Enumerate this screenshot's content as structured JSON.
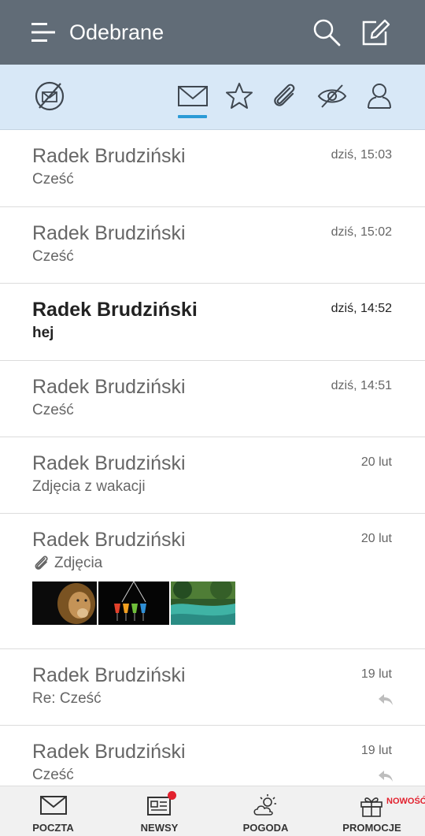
{
  "appbar": {
    "title": "Odebrane",
    "menu_icon": "hamburger-icon",
    "search_icon": "search-icon",
    "compose_icon": "compose-icon",
    "background": "#616c77"
  },
  "filters": {
    "items": [
      {
        "icon": "unread-off-icon",
        "active": false
      },
      {
        "icon": "envelope-icon",
        "active": true
      },
      {
        "icon": "star-icon",
        "active": false
      },
      {
        "icon": "paperclip-icon",
        "active": false
      },
      {
        "icon": "eye-off-icon",
        "active": false
      },
      {
        "icon": "person-icon",
        "active": false
      }
    ],
    "background": "#d8e8f7",
    "accent": "#2b9bd6"
  },
  "messages": [
    {
      "sender": "Radek Brudziński",
      "subject": "Cześć",
      "date": "dziś, 15:03",
      "unread": false
    },
    {
      "sender": "Radek Brudziński",
      "subject": "Cześć",
      "date": "dziś, 15:02",
      "unread": false
    },
    {
      "sender": "Radek Brudziński",
      "subject": "hej",
      "date": "dziś, 14:52",
      "unread": true
    },
    {
      "sender": "Radek Brudziński",
      "subject": "Cześć",
      "date": "dziś, 14:51",
      "unread": false
    },
    {
      "sender": "Radek Brudziński",
      "subject": "Zdjęcia z wakacji",
      "date": "20 lut",
      "unread": false
    },
    {
      "sender": "Radek Brudziński",
      "subject": "Zdjęcia",
      "date": "20 lut",
      "unread": false,
      "attachment": true,
      "thumbnails": [
        "lion-photo",
        "cocktails-photo",
        "river-photo"
      ]
    },
    {
      "sender": "Radek Brudziński",
      "subject": "Re: Cześć",
      "date": "19 lut",
      "unread": false,
      "replied": true
    },
    {
      "sender": "Radek Brudziński",
      "subject": "Cześć",
      "date": "19 lut",
      "unread": false,
      "replied": true
    }
  ],
  "bottom_nav": {
    "tabs": [
      {
        "label": "POCZTA",
        "icon": "mail-icon"
      },
      {
        "label": "NEWSY",
        "icon": "newspaper-icon",
        "notification": true
      },
      {
        "label": "POGODA",
        "icon": "weather-icon"
      },
      {
        "label": "PROMOCJE",
        "icon": "gift-icon",
        "badge": "NOWOŚĆ"
      }
    ],
    "badge_color": "#e2212e"
  }
}
